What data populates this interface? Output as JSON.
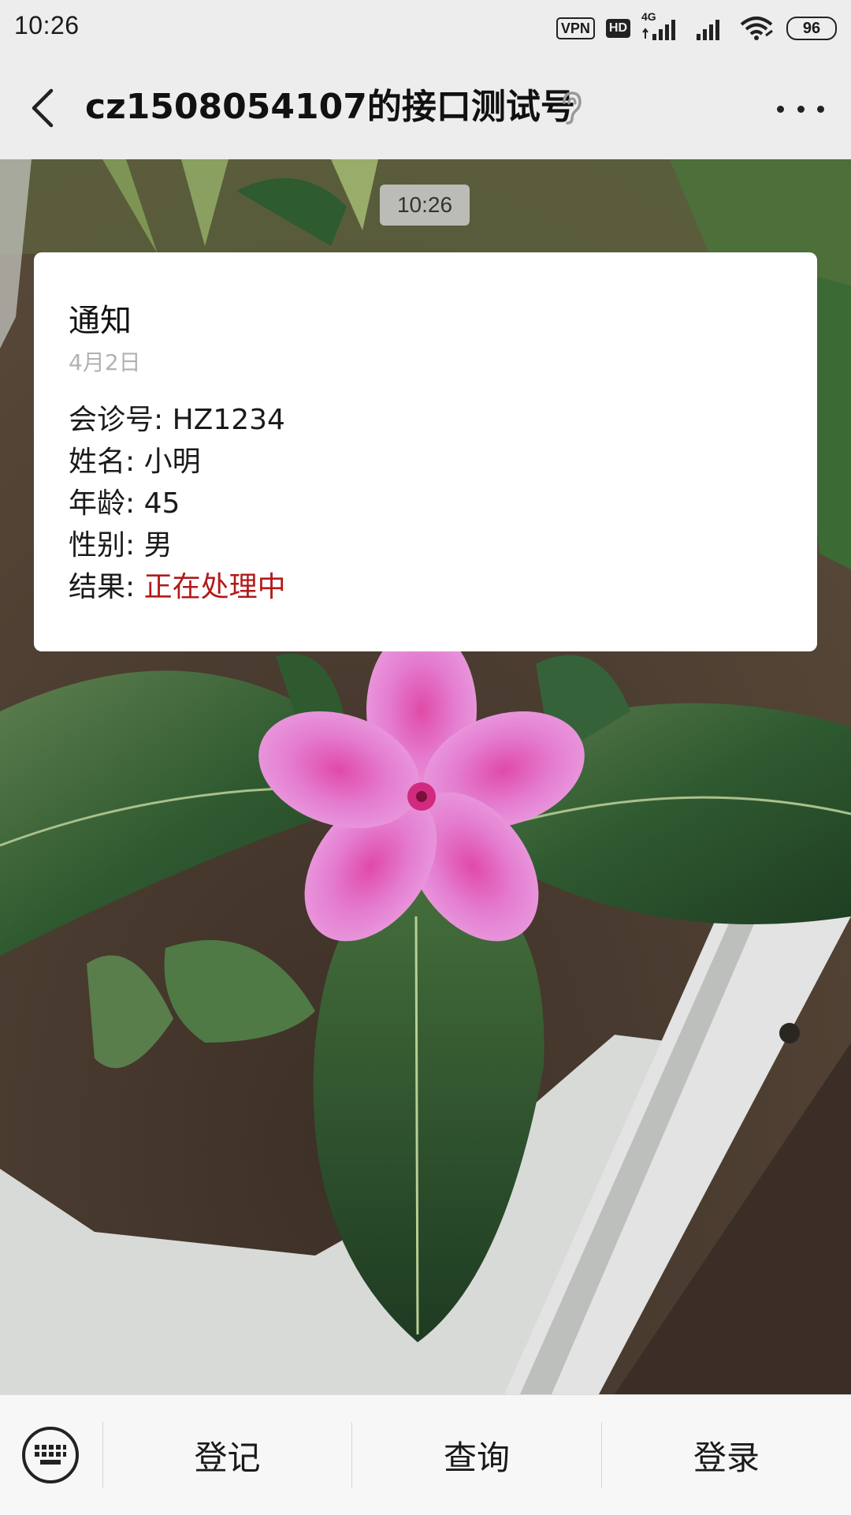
{
  "status_bar": {
    "time": "10:26",
    "vpn": "VPN",
    "hd": "HD",
    "network": "4G",
    "battery": "96"
  },
  "header": {
    "title": "cz1508054107的接口测试号",
    "icons": [
      "back-icon",
      "ear-icon",
      "more-icon"
    ]
  },
  "chat": {
    "timestamp": "10:26",
    "message_card": {
      "title": "通知",
      "date": "4月2日",
      "fields": [
        {
          "label": "会诊号:",
          "value": "HZ1234",
          "color": "#1a1a1a"
        },
        {
          "label": "姓名:",
          "value": "小明",
          "color": "#1a1a1a"
        },
        {
          "label": "年龄:",
          "value": "45",
          "color": "#1a1a1a"
        },
        {
          "label": "性别:",
          "value": "男",
          "color": "#1a1a1a"
        },
        {
          "label": "结果:",
          "value": "正在处理中",
          "color": "#b21a1a"
        }
      ]
    }
  },
  "menu": {
    "keyboard_icon": "keyboard-icon",
    "items": [
      {
        "label": "登记"
      },
      {
        "label": "查询"
      },
      {
        "label": "登录"
      }
    ]
  }
}
